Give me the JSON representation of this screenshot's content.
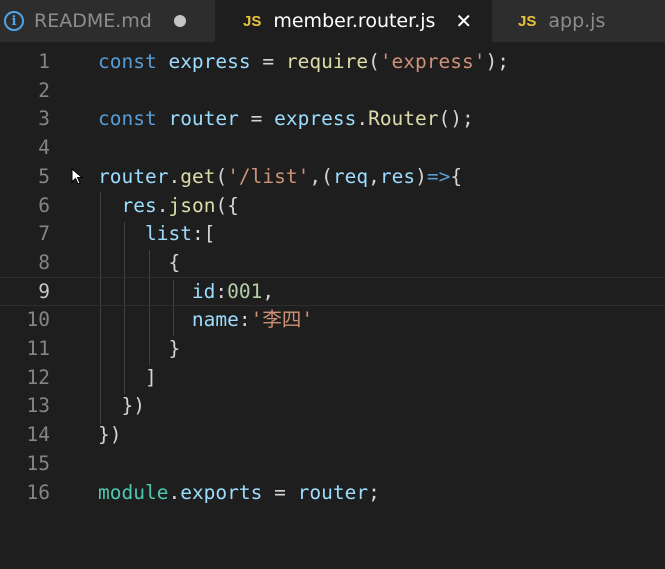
{
  "tabs": [
    {
      "label": "README.md",
      "icon": "info-icon",
      "modified": true,
      "active": false
    },
    {
      "label": "member.router.js",
      "icon_text": "JS",
      "active": true
    },
    {
      "label": "app.js",
      "icon_text": "JS",
      "active": false
    }
  ],
  "editor": {
    "current_line": 9,
    "line_numbers": [
      "1",
      "2",
      "3",
      "4",
      "5",
      "6",
      "7",
      "8",
      "9",
      "10",
      "11",
      "12",
      "13",
      "14",
      "15",
      "16"
    ],
    "lines": [
      {
        "no": "1",
        "tokens": [
          [
            "kw",
            "const"
          ],
          [
            "pl",
            " "
          ],
          [
            "var",
            "express"
          ],
          [
            "pl",
            " = "
          ],
          [
            "fn",
            "require"
          ],
          [
            "pl",
            "("
          ],
          [
            "str",
            "'express'"
          ],
          [
            "pl",
            ");"
          ]
        ]
      },
      {
        "no": "2",
        "tokens": []
      },
      {
        "no": "3",
        "tokens": [
          [
            "kw",
            "const"
          ],
          [
            "pl",
            " "
          ],
          [
            "var",
            "router"
          ],
          [
            "pl",
            " = "
          ],
          [
            "var",
            "express"
          ],
          [
            "pl",
            "."
          ],
          [
            "fn",
            "Router"
          ],
          [
            "pl",
            "();"
          ]
        ]
      },
      {
        "no": "4",
        "tokens": []
      },
      {
        "no": "5",
        "tokens": [
          [
            "var",
            "router"
          ],
          [
            "pl",
            "."
          ],
          [
            "fn",
            "get"
          ],
          [
            "pl",
            "("
          ],
          [
            "str",
            "'/list'"
          ],
          [
            "pl",
            ",("
          ],
          [
            "var",
            "req"
          ],
          [
            "pl",
            ","
          ],
          [
            "var",
            "res"
          ],
          [
            "pl",
            ")"
          ],
          [
            "kw",
            "=>"
          ],
          [
            "pl",
            "{"
          ]
        ]
      },
      {
        "no": "6",
        "tokens": [
          [
            "pl",
            "  "
          ],
          [
            "var",
            "res"
          ],
          [
            "pl",
            "."
          ],
          [
            "fn",
            "json"
          ],
          [
            "pl",
            "({"
          ]
        ]
      },
      {
        "no": "7",
        "tokens": [
          [
            "pl",
            "    "
          ],
          [
            "var",
            "list"
          ],
          [
            "pl",
            ":["
          ]
        ]
      },
      {
        "no": "8",
        "tokens": [
          [
            "pl",
            "      {"
          ]
        ]
      },
      {
        "no": "9",
        "tokens": [
          [
            "pl",
            "        "
          ],
          [
            "var",
            "id"
          ],
          [
            "pl",
            ":"
          ],
          [
            "num",
            "001"
          ],
          [
            "pl",
            ","
          ]
        ]
      },
      {
        "no": "10",
        "tokens": [
          [
            "pl",
            "        "
          ],
          [
            "var",
            "name"
          ],
          [
            "pl",
            ":"
          ],
          [
            "str",
            "'李四'"
          ]
        ]
      },
      {
        "no": "11",
        "tokens": [
          [
            "pl",
            "      }"
          ]
        ]
      },
      {
        "no": "12",
        "tokens": [
          [
            "pl",
            "    ]"
          ]
        ]
      },
      {
        "no": "13",
        "tokens": [
          [
            "pl",
            "  })"
          ]
        ]
      },
      {
        "no": "14",
        "tokens": [
          [
            "pl",
            "})"
          ]
        ]
      },
      {
        "no": "15",
        "tokens": []
      },
      {
        "no": "16",
        "tokens": [
          [
            "cls",
            "module"
          ],
          [
            "pl",
            "."
          ],
          [
            "var",
            "exports"
          ],
          [
            "pl",
            " = "
          ],
          [
            "var",
            "router"
          ],
          [
            "pl",
            ";"
          ]
        ]
      }
    ]
  },
  "colors": {
    "keyword": "#569cd6",
    "variable": "#9cdcfe",
    "function": "#dcdcaa",
    "string": "#ce9178",
    "number": "#b5cea8",
    "class": "#4ec9b0",
    "js_icon": "#e8c340",
    "info_icon": "#4fa5e8"
  }
}
